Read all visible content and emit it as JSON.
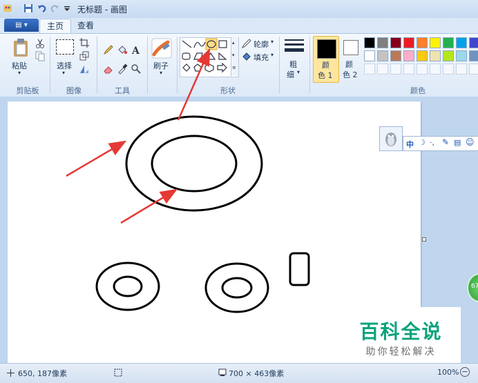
{
  "window": {
    "title": "无标题 - 画图"
  },
  "tabs": {
    "file_label": "▤ ▾",
    "home": "主页",
    "view": "查看"
  },
  "ribbon": {
    "clipboard": {
      "paste": "粘贴",
      "group": "剪贴板"
    },
    "image": {
      "select": "选择",
      "group": "图像"
    },
    "tools": {
      "group": "工具"
    },
    "brushes": {
      "label": "刷子"
    },
    "shapes": {
      "outline": "轮廓",
      "fill": "填充",
      "group": "形状"
    },
    "size": {
      "label_1": "粗",
      "label_2": "细"
    },
    "color1": {
      "label_1": "颜",
      "label_2": "色 1"
    },
    "color2": {
      "label_1": "颜",
      "label_2": "色 2"
    },
    "colors": {
      "group": "颜色"
    }
  },
  "palette": {
    "row1": [
      "#000000",
      "#7f7f7f",
      "#880015",
      "#ed1c24",
      "#ff7f27",
      "#fff200",
      "#22b14c",
      "#00a2e8",
      "#3f48cc"
    ],
    "row2": [
      "#ffffff",
      "#c3c3c3",
      "#b97a57",
      "#ffaec9",
      "#ffc90e",
      "#efe4b0",
      "#b5e61d",
      "#99d9ea",
      "#7092be"
    ]
  },
  "qq_toolbar": {
    "ime": "中"
  },
  "status": {
    "cursor_pos": "650, 187像素",
    "canvas_size": "700 × 463像素",
    "zoom": "100%"
  },
  "side_badge": "67",
  "watermark": {
    "title": "百科全说",
    "subtitle": "助你轻松解决"
  }
}
